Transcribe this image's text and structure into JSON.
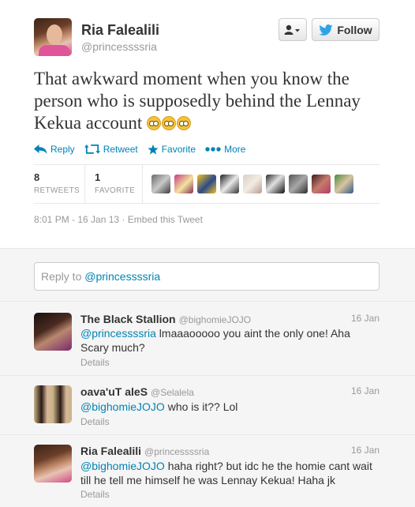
{
  "tweet": {
    "author_name": "Ria Falealili",
    "author_handle": "@princessssria",
    "follow_label": "Follow",
    "text": "That awkward moment when you know the person who is supposedly behind the Lennay Kekua account",
    "actions": {
      "reply": "Reply",
      "retweet": "Retweet",
      "favorite": "Favorite",
      "more": "More"
    },
    "stats": {
      "retweets_count": "8",
      "retweets_label": "RETWEETS",
      "favorites_count": "1",
      "favorites_label": "FAVORITE"
    },
    "timestamp": "8:01 PM - 16 Jan 13",
    "separator": "·",
    "embed_label": "Embed this Tweet"
  },
  "reply_box": {
    "prefix": "Reply to",
    "mention": "@princessssria"
  },
  "replies": [
    {
      "name": "The Black Stallion",
      "handle": "@bighomieJOJO",
      "date": "16 Jan",
      "mention": "@princessssria",
      "text": " lmaaaooooo you aint the only one! Aha Scary much?",
      "details": "Details"
    },
    {
      "name": "oava'uT aleS",
      "handle": "@Selalela",
      "date": "16 Jan",
      "mention": "@bighomieJOJO",
      "text": " who is it?? Lol",
      "details": "Details"
    },
    {
      "name": "Ria Falealili",
      "handle": "@princessssria",
      "date": "16 Jan",
      "mention": "@bighomieJOJO",
      "text": " haha right? but idc he the homie cant wait till he tell me himself he was Lennay Kekua! Haha jk",
      "details": "Details"
    }
  ],
  "colors": {
    "link": "#0084b4",
    "muted": "#999999",
    "text": "#333333",
    "twitter_bird": "#2fa3e6"
  }
}
